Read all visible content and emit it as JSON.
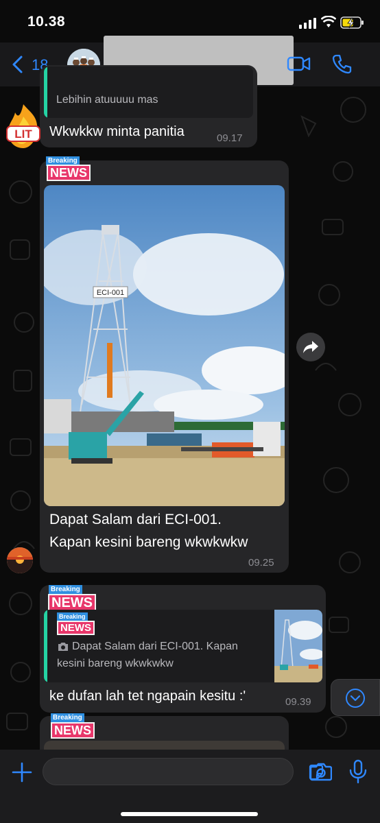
{
  "status_bar": {
    "time": "10.38"
  },
  "header": {
    "back_count": "18"
  },
  "messages": [
    {
      "quote_text": "Lebihin atuuuuu mas",
      "text": "Wkwkkw minta panitia",
      "time": "09.17",
      "sticker": "LIT"
    },
    {
      "tag_top": "Breaking",
      "tag_bottom": "NEWS",
      "photo_sign": "ECI-001",
      "caption_line1": "Dapat Salam dari ECI-001.",
      "caption_line2": "Kapan kesini bareng wkwkwkw",
      "time": "09.25"
    },
    {
      "tag_top": "Breaking",
      "tag_bottom": "NEWS",
      "quote_tag_top": "Breaking",
      "quote_tag_bottom": "NEWS",
      "quote_line1": "Dapat Salam dari ECI-001. Kapan",
      "quote_line2": "kesini bareng wkwkwkw",
      "text": "ke dufan lah tet ngapain kesitu :'",
      "time": "09.39"
    },
    {
      "tag_top": "Breaking",
      "tag_bottom": "NEWS"
    }
  ],
  "colors": {
    "accent": "#2f88ff",
    "bubble": "#262628",
    "quote_bar": "#25d3a4",
    "news_red": "#e8366a",
    "news_blue": "#2f8fe0"
  },
  "icons": [
    "back-chevron-icon",
    "video-call-icon",
    "phone-icon",
    "forward-icon",
    "chevron-down-icon",
    "plus-icon",
    "sticker-icon",
    "camera-icon",
    "microphone-icon"
  ]
}
